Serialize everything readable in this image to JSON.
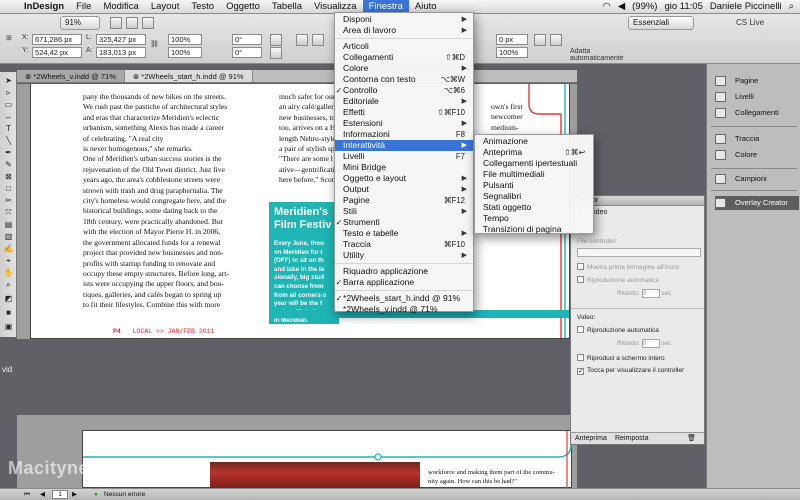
{
  "menubar": {
    "app": "InDesign",
    "items": [
      "File",
      "Modifica",
      "Layout",
      "Testo",
      "Oggetto",
      "Tabella",
      "Visualizza",
      "Finestra",
      "Aiuto"
    ],
    "active": "Finestra",
    "battery": "(99%)",
    "clock": "gio 11:05",
    "user": "Daniele Piccinelli"
  },
  "controlbar": {
    "zoom": "91%",
    "x": "671,286 px",
    "y": "524,42 px",
    "w": "325,427 px",
    "h": "183,013 px",
    "scale_x": "100%",
    "scale_y": "100%",
    "rot": "0°",
    "shear": "0°",
    "stroke_w": "0 px",
    "stroke_pct": "100%",
    "opacity": "0 px",
    "adapt": "Adatta automaticamente",
    "workspace": "Essenziali",
    "cslive": "CS Live"
  },
  "tabs": [
    "*2Wheels_v.indd @ 71%",
    "*2Wheels_start_h.indd @ 91%"
  ],
  "document": {
    "col1": "pany the thousands of new bikes on the streets.\nWe rush past the pastiche of architectural styles\nand eras that characterize Meridien's eclectic\nurbanism, something Alexis has made a career\nof celebrating. \"A real city\nis never homogenous,\" she remarks.\n    One of Meridien's urban success stories is the\nrejuvenation of the Old Town district. Just five\nyears ago, the area's cobblestone streets were\nstrewn with trash and drug paraphernalia. The\ncity's homeless would congregate here, and the\nhistorical buildings, some dating back to the\n18th century, were practically abandoned. But\nwith the election of Mayor Pierre H. in 2006,\nthe government allocated funds for a renewal\nproject that provided new businesses and non-\nprofits with startup funding to renovate and\noccupy these empty structures. Before long, art-\nists were occupying the upper floors, and bou-\ntiques, galleries, and cafés began to spring up\nto fit their lifestyles. Combine this with more",
    "col2": "much safer for our c\nan airy café/gallery\nnew businesses, to\ntoo, arrives on a HU\nlength Nehru-style\na pair of stylish spe\n    \"There are some l\native—gentrificatio\nhere before,\" Scott",
    "col3": "own's first\nnewcomer\nmedium-",
    "sidebar_title": "Meridien's\nFilm Festiv",
    "sidebar_text": "Every June, thou\non Meridien for t\n(OFF) to sit on th\nand take in the la\nsionally, big stud\ncan choose from\nfrom all corners o\nyear will be the f\nseries, \"Paladin,\nin Meridien.",
    "footer_p": "P4",
    "footer_local": "LOCAL >> JAN/FEB 2011",
    "page2_text": "workforce and making them part of the commu-\nnity again. How can this be had?\""
  },
  "finestra_menu": [
    {
      "label": "Disponi",
      "arrow": true
    },
    {
      "label": "Area di lavoro",
      "arrow": true
    },
    {
      "sep": true
    },
    {
      "label": "Articoli"
    },
    {
      "label": "Collegamenti",
      "shortcut": "⇧⌘D"
    },
    {
      "label": "Colore",
      "arrow": true
    },
    {
      "label": "Contorna con testo",
      "shortcut": "⌥⌘W"
    },
    {
      "label": "Controllo",
      "shortcut": "⌥⌘6",
      "check": true
    },
    {
      "label": "Editoriale",
      "arrow": true
    },
    {
      "label": "Effetti",
      "shortcut": "⇧⌘F10"
    },
    {
      "label": "Estensioni",
      "arrow": true
    },
    {
      "label": "Informazioni",
      "shortcut": "F8"
    },
    {
      "label": "Interattività",
      "arrow": true,
      "highlight": true
    },
    {
      "label": "Livelli",
      "shortcut": "F7"
    },
    {
      "label": "Mini Bridge"
    },
    {
      "label": "Oggetto e layout",
      "arrow": true
    },
    {
      "label": "Output",
      "arrow": true
    },
    {
      "label": "Pagine",
      "shortcut": "⌘F12"
    },
    {
      "label": "Stili",
      "arrow": true
    },
    {
      "label": "Strumenti",
      "check": true
    },
    {
      "label": "Testo e tabelle",
      "arrow": true
    },
    {
      "label": "Traccia",
      "shortcut": "⌘F10"
    },
    {
      "label": "Utility",
      "arrow": true
    },
    {
      "sep": true
    },
    {
      "label": "Riquadro applicazione"
    },
    {
      "label": "Barra applicazione",
      "check": true
    },
    {
      "sep": true
    },
    {
      "label": "*2Wheels_start_h.indd @ 91%",
      "check": true
    },
    {
      "label": "*2Wheels_v.indd @ 71%"
    }
  ],
  "submenu": [
    {
      "label": "Animazione"
    },
    {
      "label": "Anteprima",
      "shortcut": "⇧⌘↩"
    },
    {
      "label": "Collegamenti ipertestuali"
    },
    {
      "label": "File multimediali"
    },
    {
      "label": "Pulsanti"
    },
    {
      "label": "Segnalibri"
    },
    {
      "label": "Stati oggetto"
    },
    {
      "label": "Tempo"
    },
    {
      "label": "Transizioni di pagina"
    }
  ],
  "dock": [
    {
      "label": "Pagine",
      "icon": "pages-icon"
    },
    {
      "label": "Livelli",
      "icon": "layers-icon"
    },
    {
      "label": "Collegamenti",
      "icon": "links-icon"
    },
    {
      "label": "Traccia",
      "icon": "stroke-icon"
    },
    {
      "label": "Colore",
      "icon": "color-icon"
    },
    {
      "label": "Campioni",
      "icon": "swatches-icon"
    },
    {
      "label": "Overlay Creator",
      "icon": "overlay-icon"
    }
  ],
  "overlay_panel": {
    "title": "Creator",
    "section": "to e video",
    "file_label": "File controller:",
    "opt1": "Mostra prima immagine all'inizio",
    "opt2": "Riproduzione automatica",
    "ritardo1": "Ritardo:",
    "ritardo1_val": "0",
    "ritardo1_unit": "sec",
    "video_label": "Video:",
    "opt3": "Riproduzione automatica",
    "ritardo2": "Ritardo:",
    "ritardo2_val": "0",
    "ritardo2_unit": "sec",
    "opt4": "Riproduci a schermo intero",
    "opt5": "Tocca per visualizzare il controller",
    "tab1": "Anteprima",
    "tab2": "Reimposta"
  },
  "statusbar": {
    "page": "1",
    "errors": "Nessun errore"
  },
  "watermark": "Macitynet.it",
  "desktop_label": "vid"
}
